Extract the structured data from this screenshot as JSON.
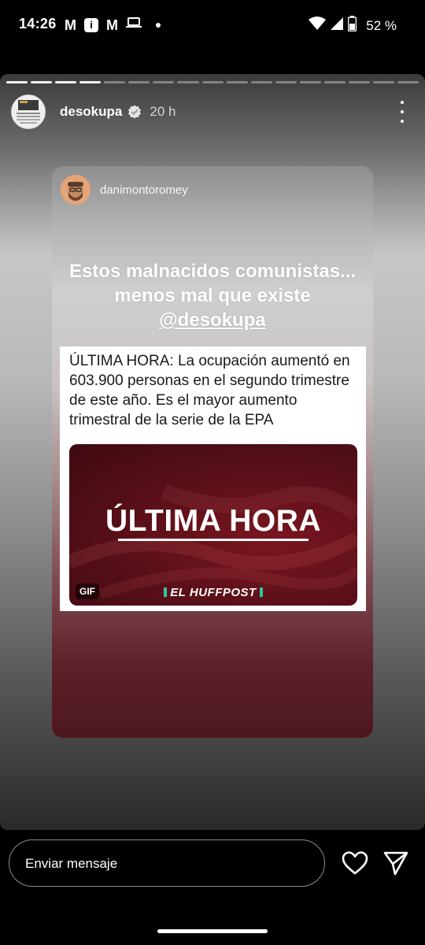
{
  "status_bar": {
    "time": "14:26",
    "notification_icons": [
      "gmail-icon",
      "info-icon",
      "metro-m-icon",
      "laptop-icon",
      "dot-icon"
    ],
    "notification_glyphs": [
      "M",
      "i",
      "M"
    ],
    "battery": "52 %"
  },
  "story": {
    "progress_total": 17,
    "progress_done": 4,
    "username": "desokupa",
    "time_ago": "20 h",
    "post": {
      "username": "danimontoromey",
      "quote_prefix": "Estos malnacidos comunistas... menos mal que existe ",
      "quote_mention": "@desokupa",
      "tweet_text": "ÚLTIMA HORA: La ocupación aumentó en 603.900 personas en el segundo trimestre de este año. Es el mayor aumento trimestral de la serie de la EPA",
      "media": {
        "title": "ÚLTIMA HORA",
        "badge": "GIF",
        "source": "EL HUFFPOST"
      }
    }
  },
  "reply_bar": {
    "placeholder": "Enviar mensaje"
  },
  "colors": {
    "background": "#000000",
    "media_red": "#6b121c",
    "huffpost_green": "#2ac99c"
  }
}
